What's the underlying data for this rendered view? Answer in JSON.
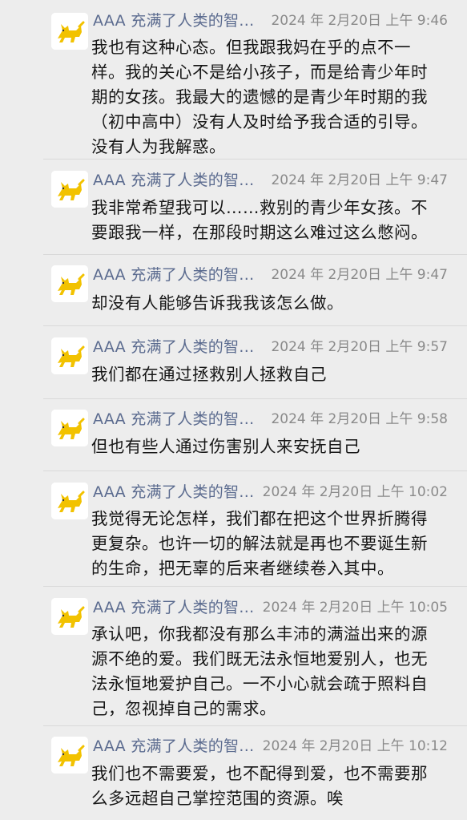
{
  "messages": [
    {
      "sender": "AAA 充满了人类的智...",
      "time": "2024 年 2月20日 上午 9:46",
      "text": "我也有这种心态。但我跟我妈在乎的点不一样。我的关心不是给小孩子，而是给青少年时期的女孩。我最大的遗憾的是青少年时期的我（初中高中）没有人及时给予我合适的引导。没有人为我解惑。"
    },
    {
      "sender": "AAA 充满了人类的智...",
      "time": "2024 年 2月20日 上午 9:47",
      "text": "我非常希望我可以……救别的青少年女孩。不要跟我一样，在那段时期这么难过这么憋闷。"
    },
    {
      "sender": "AAA 充满了人类的智...",
      "time": "2024 年 2月20日 上午 9:47",
      "text": "却没有人能够告诉我我该怎么做。"
    },
    {
      "sender": "AAA 充满了人类的智...",
      "time": "2024 年 2月20日 上午 9:57",
      "text": "我们都在通过拯救别人拯救自己"
    },
    {
      "sender": "AAA 充满了人类的智...",
      "time": "2024 年 2月20日 上午 9:58",
      "text": "但也有些人通过伤害别人来安抚自己"
    },
    {
      "sender": "AAA 充满了人类的智...",
      "time": "2024 年 2月20日 上午 10:02",
      "text": "我觉得无论怎样，我们都在把这个世界折腾得更复杂。也许一切的解法就是再也不要诞生新的生命，把无辜的后来者继续卷入其中。"
    },
    {
      "sender": "AAA 充满了人类的智...",
      "time": "2024 年 2月20日 上午 10:05",
      "text": "承认吧，你我都没有那么丰沛的满溢出来的源源不绝的爱。我们既无法永恒地爱别人，也无法永恒地爱护自己。一不小心就会疏于照料自己，忽视掉自己的需求。"
    },
    {
      "sender": "AAA 充满了人类的智...",
      "time": "2024 年 2月20日 上午 10:12",
      "text": "我们也不需要爱，也不配得到爱，也不需要那么多远超自己掌控范围的资源。唉"
    }
  ],
  "colors": {
    "background": "#ededed",
    "sender": "#5b6b8f",
    "time": "#8a8a8a",
    "text": "#161616",
    "avatar_figure": "#f2c200"
  },
  "icons": {
    "avatar": "yellow-cat-avatar-icon"
  }
}
